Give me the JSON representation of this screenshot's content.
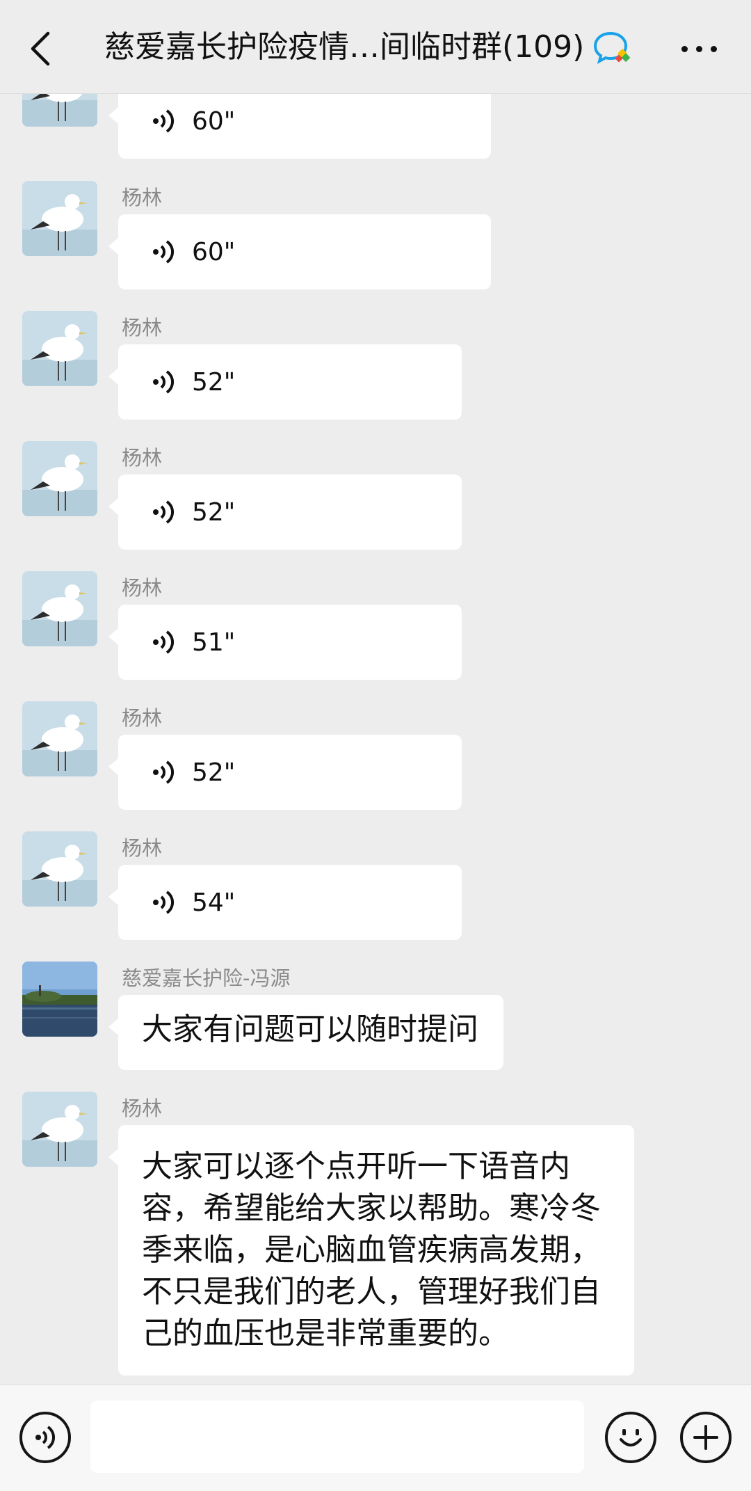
{
  "header": {
    "back_icon": "chevron-left-icon",
    "title": "慈爱嘉长护险疫情…间临时群(109)",
    "title_icon": "group-chat-icon",
    "more_icon": "more-dots-icon"
  },
  "messages": [
    {
      "type": "voice",
      "sender": "",
      "duration": "60\"",
      "avatar": "seagull-avatar"
    },
    {
      "type": "voice",
      "sender": "杨林",
      "duration": "60\"",
      "avatar": "seagull-avatar"
    },
    {
      "type": "voice",
      "sender": "杨林",
      "duration": "52\"",
      "avatar": "seagull-avatar"
    },
    {
      "type": "voice",
      "sender": "杨林",
      "duration": "52\"",
      "avatar": "seagull-avatar"
    },
    {
      "type": "voice",
      "sender": "杨林",
      "duration": "51\"",
      "avatar": "seagull-avatar"
    },
    {
      "type": "voice",
      "sender": "杨林",
      "duration": "52\"",
      "avatar": "seagull-avatar"
    },
    {
      "type": "voice",
      "sender": "杨林",
      "duration": "54\"",
      "avatar": "seagull-avatar"
    },
    {
      "type": "text",
      "sender": "慈爱嘉长护险-冯源",
      "text": "大家有问题可以随时提问",
      "avatar": "lake-avatar"
    },
    {
      "type": "text",
      "sender": "杨林",
      "lines": [
        "大家可以逐个点开听一下语音内",
        "容，希望能给大家以帮助。寒冷冬",
        "季来临，是心脑血管疾病高发期，",
        "不只是我们的老人，管理好我们自",
        "己的血压也是非常重要的。"
      ],
      "avatar": "seagull-avatar"
    }
  ],
  "input_bar": {
    "voice_icon": "voice-mode-icon",
    "input_value": "",
    "emoji_icon": "emoji-icon",
    "plus_icon": "plus-icon"
  },
  "colors": {
    "background": "#ededed",
    "bubble": "#ffffff",
    "sender_text": "#8a8a8a"
  }
}
